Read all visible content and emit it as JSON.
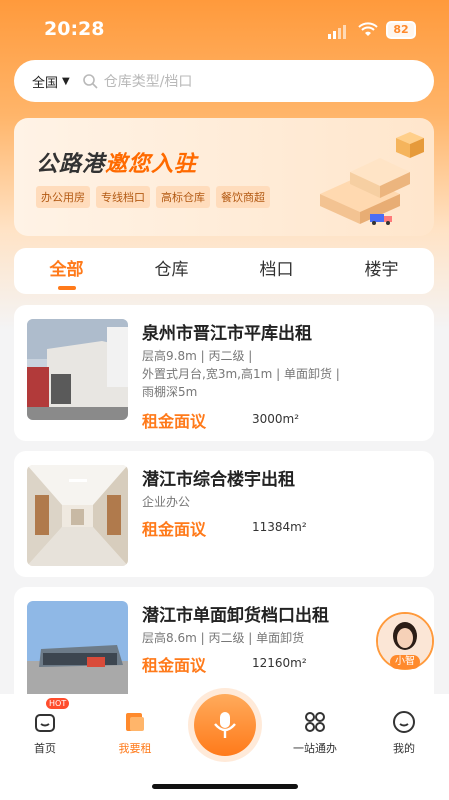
{
  "status_bar": {
    "time": "20:28",
    "battery": "82"
  },
  "search": {
    "region": "全国",
    "placeholder": "仓库类型/档口"
  },
  "banner": {
    "title_prefix": "公路港",
    "title_highlight": "邀您入驻",
    "tags": [
      "办公用房",
      "专线档口",
      "高标仓库",
      "餐饮商超"
    ]
  },
  "tabs": [
    {
      "label": "全部",
      "active": true
    },
    {
      "label": "仓库",
      "active": false
    },
    {
      "label": "档口",
      "active": false
    },
    {
      "label": "楼宇",
      "active": false
    }
  ],
  "listings": [
    {
      "title": "泉州市晋江市平库出租",
      "desc_lines": [
        "层高9.8m | 丙二级 |",
        "外置式月台,宽3m,高1m | 单面卸货 |",
        "雨棚深5m"
      ],
      "price": "租金面议",
      "area": "3000m²"
    },
    {
      "title": "潜江市综合楼宇出租",
      "desc_lines": [
        "企业办公"
      ],
      "price": "租金面议",
      "area": "11384m²"
    },
    {
      "title": "潜江市单面卸货档口出租",
      "desc_lines": [
        "层高8.6m | 丙二级 | 单面卸货"
      ],
      "price": "租金面议",
      "area": "12160m²"
    }
  ],
  "assistant": {
    "label": "小智"
  },
  "nav": {
    "hot_badge": "HOT",
    "items": [
      {
        "label": "首页",
        "icon": "home-icon",
        "active": false
      },
      {
        "label": "我要租",
        "icon": "rent-icon",
        "active": true
      },
      {
        "label": "一站通办",
        "icon": "grid-icon",
        "active": false
      },
      {
        "label": "我的",
        "icon": "smile-icon",
        "active": false
      }
    ]
  },
  "colors": {
    "accent": "#ff7a1a",
    "accent_light": "#ffb56a",
    "page_bg": "#f4f4f5"
  }
}
